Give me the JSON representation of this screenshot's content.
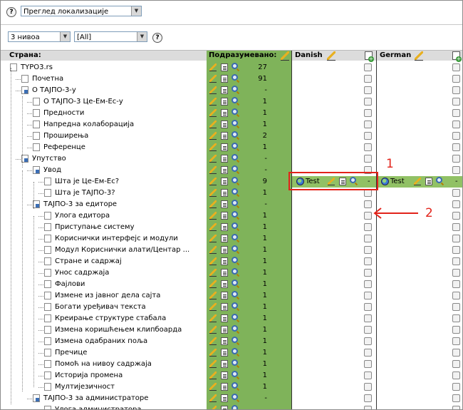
{
  "toolbar": {
    "view_select": "Преглед локализације",
    "levels_select": "3 нивоа",
    "language_select": "[All]"
  },
  "columns": {
    "page": "Страна:",
    "default": "Подразумевано:",
    "danish": "Danish",
    "german": "German"
  },
  "rows": [
    {
      "title": "TYPO3.rs",
      "count": "27"
    },
    {
      "title": "Почетна",
      "count": "91"
    },
    {
      "title": "О ТАЈПО-3-у",
      "count": "-"
    },
    {
      "title": "О ТАЈПО-3 Це-Ем-Ес-у",
      "count": "1"
    },
    {
      "title": "Предности",
      "count": "1"
    },
    {
      "title": "Напредна колаборација",
      "count": "1"
    },
    {
      "title": "Проширења",
      "count": "2"
    },
    {
      "title": "Референце",
      "count": "1"
    },
    {
      "title": "Упутство",
      "count": "-"
    },
    {
      "title": "Увод",
      "count": "-"
    },
    {
      "title": "Шта је Це-Ем-Ес?",
      "count": "9"
    },
    {
      "title": "Шта је ТАЈПО-3?",
      "count": "1"
    },
    {
      "title": "ТАЈПО-3 за едиторе",
      "count": "-"
    },
    {
      "title": "Улога едитора",
      "count": "1"
    },
    {
      "title": "Приступање систему",
      "count": "1"
    },
    {
      "title": "Кориснички интерфејс и модули",
      "count": "1"
    },
    {
      "title": "Модул Кориснички алати/Центар ...",
      "count": "1"
    },
    {
      "title": "Стране и садржај",
      "count": "1"
    },
    {
      "title": "Унос садржаја",
      "count": "1"
    },
    {
      "title": "Фајлови",
      "count": "1"
    },
    {
      "title": "Измене из јавног дела сајта",
      "count": "1"
    },
    {
      "title": "Богати уређивач текста",
      "count": "1"
    },
    {
      "title": "Креирање структуре стабала",
      "count": "1"
    },
    {
      "title": "Измена коришћењем клипбоарда",
      "count": "1"
    },
    {
      "title": "Измена одабраних поља",
      "count": "1"
    },
    {
      "title": "Пречице",
      "count": "1"
    },
    {
      "title": "Помоћ на нивоу садржаја",
      "count": "1"
    },
    {
      "title": "Историја промена",
      "count": "1"
    },
    {
      "title": "Мултијезичност",
      "count": "1"
    },
    {
      "title": "ТАЈПО-3 за администраторе",
      "count": "-"
    },
    {
      "title": "Улога администратора",
      "count": ""
    }
  ],
  "translation": {
    "danish_label": "Test",
    "danish_count": "-",
    "german_label": "Test",
    "german_count": "-"
  },
  "annotations": {
    "one": "1",
    "two": "2"
  },
  "colors": {
    "default_column": "#7fb35a",
    "translated": "#91c165",
    "annotation": "#e2231a"
  }
}
